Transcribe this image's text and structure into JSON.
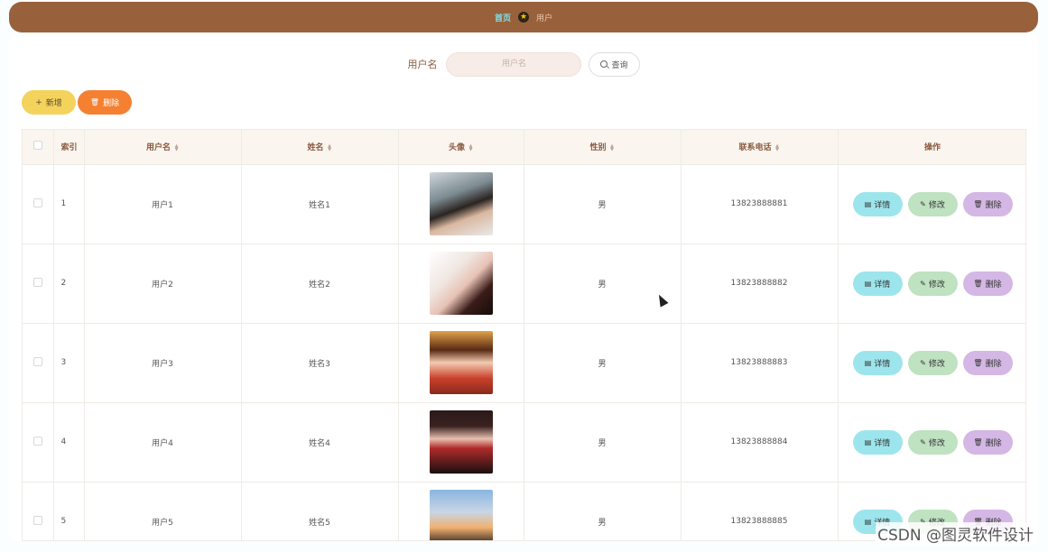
{
  "breadcrumb": {
    "home": "首页",
    "separator_icon": "star-icon",
    "current": "用户"
  },
  "search": {
    "label": "用户名",
    "placeholder": "用户名",
    "button": "查询"
  },
  "actions": {
    "add": "新增",
    "delete": "删除"
  },
  "table": {
    "headers": [
      "索引",
      "用户名",
      "姓名",
      "头像",
      "性别",
      "联系电话",
      "操作"
    ],
    "rows": [
      {
        "index": "1",
        "username": "用户1",
        "name": "姓名1",
        "gender": "男",
        "phone": "13823888881"
      },
      {
        "index": "2",
        "username": "用户2",
        "name": "姓名2",
        "gender": "男",
        "phone": "13823888882"
      },
      {
        "index": "3",
        "username": "用户3",
        "name": "姓名3",
        "gender": "男",
        "phone": "13823888883"
      },
      {
        "index": "4",
        "username": "用户4",
        "name": "姓名4",
        "gender": "男",
        "phone": "13823888884"
      },
      {
        "index": "5",
        "username": "用户5",
        "name": "姓名5",
        "gender": "男",
        "phone": "13823888885"
      }
    ],
    "row_actions": {
      "detail": "详情",
      "edit": "修改",
      "delete": "删除"
    }
  },
  "watermark": "CSDN @图灵软件设计",
  "colors": {
    "header_bar": "#99613b",
    "add": "#f3d35c",
    "delete": "#f58032",
    "detail": "#9de5ec",
    "edit": "#bfe2c0",
    "row_delete": "#d4b7e4"
  }
}
